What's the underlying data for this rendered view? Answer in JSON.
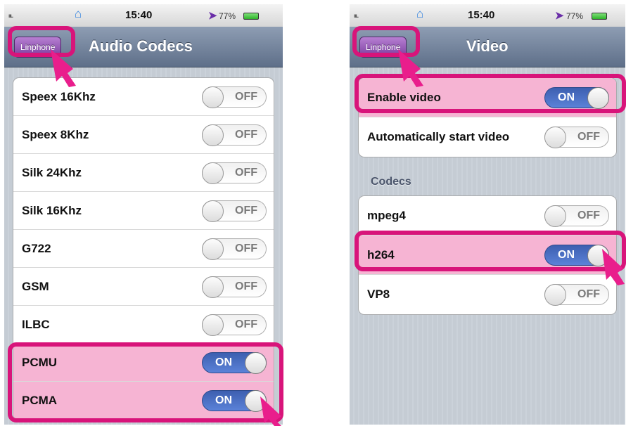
{
  "left": {
    "status": {
      "time": "15:40",
      "battery": "77%",
      "signal": "ııı.."
    },
    "back_button": "Linphone",
    "title": "Audio Codecs",
    "rows": [
      {
        "label": "Speex 16Khz",
        "toggle": "OFF",
        "on": false
      },
      {
        "label": "Speex 8Khz",
        "toggle": "OFF",
        "on": false
      },
      {
        "label": "Silk 24Khz",
        "toggle": "OFF",
        "on": false
      },
      {
        "label": "Silk 16Khz",
        "toggle": "OFF",
        "on": false
      },
      {
        "label": "G722",
        "toggle": "OFF",
        "on": false
      },
      {
        "label": "GSM",
        "toggle": "OFF",
        "on": false
      },
      {
        "label": "ILBC",
        "toggle": "OFF",
        "on": false
      },
      {
        "label": "PCMU",
        "toggle": "ON",
        "on": true
      },
      {
        "label": "PCMA",
        "toggle": "ON",
        "on": true
      }
    ]
  },
  "right": {
    "status": {
      "time": "15:40",
      "battery": "77%",
      "signal": "ııı.."
    },
    "back_button": "Linphone",
    "title": "Video",
    "group1": [
      {
        "label": "Enable video",
        "toggle": "ON",
        "on": true
      },
      {
        "label": "Automatically start video",
        "toggle": "OFF",
        "on": false
      }
    ],
    "section_header": "Codecs",
    "group2": [
      {
        "label": "mpeg4",
        "toggle": "OFF",
        "on": false
      },
      {
        "label": "h264",
        "toggle": "ON",
        "on": true
      },
      {
        "label": "VP8",
        "toggle": "OFF",
        "on": false
      }
    ]
  },
  "colors": {
    "highlight": "#d8147a",
    "highlight_fill": "#f6b4d3",
    "toggle_on": "#4a6fc4",
    "navbar": "#6f7f98"
  }
}
